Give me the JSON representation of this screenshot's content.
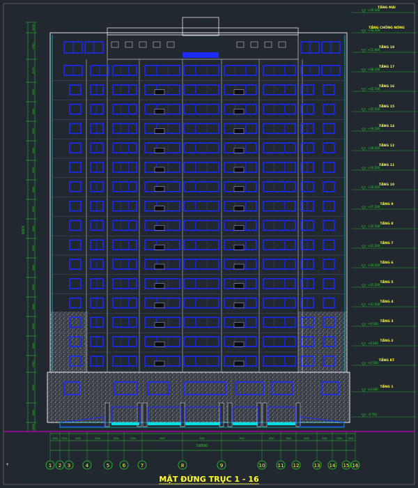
{
  "drawing": {
    "title": "MẶT ĐỨNG TRỤC 1 - 16",
    "floors": [
      {
        "label": "TẦNG MÁI",
        "elev": "+59.500"
      },
      {
        "label": "TẦNG CHỐNG NÓNG",
        "elev": "+56.200"
      },
      {
        "label": "TẦNG 18",
        "elev": "+51.800"
      },
      {
        "label": "TẦNG 17",
        "elev": "+48.500"
      },
      {
        "label": "TẦNG 16",
        "elev": "+45.500"
      },
      {
        "label": "TẦNG 15",
        "elev": "+42.500"
      },
      {
        "label": "TẦNG 14",
        "elev": "+39.500"
      },
      {
        "label": "TẦNG 12",
        "elev": "+36.500"
      },
      {
        "label": "TẦNG 11",
        "elev": "+33.500"
      },
      {
        "label": "TẦNG 10",
        "elev": "+30.500"
      },
      {
        "label": "TẦNG 9",
        "elev": "+27.500"
      },
      {
        "label": "TẦNG 8",
        "elev": "+24.500"
      },
      {
        "label": "TẦNG 7",
        "elev": "+21.500"
      },
      {
        "label": "TẦNG 6",
        "elev": "+18.500"
      },
      {
        "label": "TẦNG 5",
        "elev": "+15.500"
      },
      {
        "label": "TẦNG 4",
        "elev": "+12.500"
      },
      {
        "label": "TẦNG 3",
        "elev": "+9.500"
      },
      {
        "label": "TẦNG 2",
        "elev": "+6.500"
      },
      {
        "label": "TẦNG KT",
        "elev": "+4.500"
      },
      {
        "label": "TẦNG 1",
        "elev": "±0.000"
      },
      {
        "label": "",
        "elev": "-0.750"
      }
    ],
    "axes": [
      "1",
      "2",
      "3",
      "4",
      "5",
      "6",
      "7",
      "8",
      "9",
      "10",
      "11",
      "12",
      "13",
      "14",
      "15",
      "16"
    ],
    "overall_dim": "59500",
    "colors": {
      "background": "#212830",
      "outline": "#e8e8e8",
      "window": "#1c2bff",
      "label": "#ffff33",
      "dimension": "#28d828",
      "accent": "#ff33ff",
      "ground": "#c000c0",
      "cyan": "#00e0e0"
    }
  }
}
